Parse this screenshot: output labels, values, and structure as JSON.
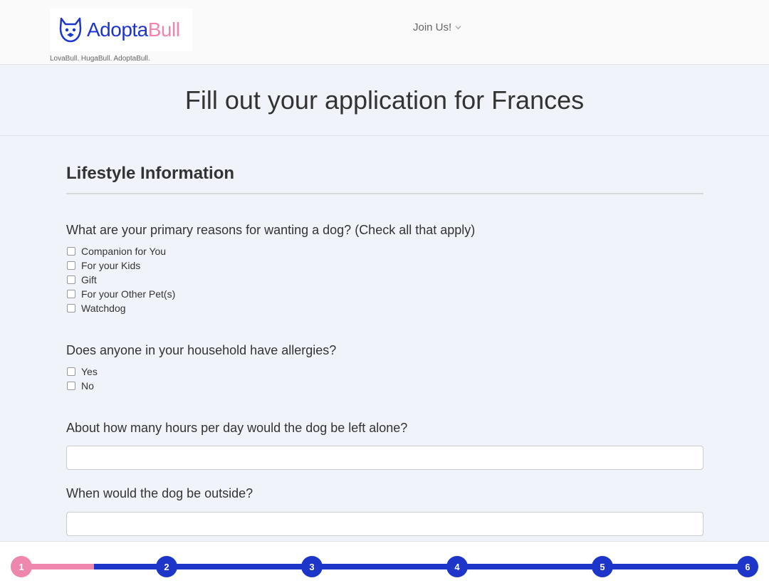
{
  "brand": {
    "name_part1": "Adopta",
    "name_part2": "Bull",
    "tagline": "LovaBull. HugaBull. AdoptaBull.",
    "colors": {
      "primary": "#1d35c9",
      "accent": "#ee86ad"
    },
    "logo_icon": "bulldog-face-icon"
  },
  "nav": {
    "join_label": "Join Us!",
    "join_icon": "chevron-down-icon"
  },
  "page": {
    "title": "Fill out your application for Frances"
  },
  "section": {
    "title": "Lifestyle Information"
  },
  "questions": {
    "reasons": {
      "label": "What are your primary reasons for wanting a dog? (Check all that apply)",
      "options": [
        "Companion for You",
        "For your Kids",
        "Gift",
        "For your Other Pet(s)",
        "Watchdog"
      ]
    },
    "allergies": {
      "label": "Does anyone in your household have allergies?",
      "options": [
        "Yes",
        "No"
      ]
    },
    "hours_alone": {
      "label": "About how many hours per day would the dog be left alone?",
      "value": "",
      "placeholder": ""
    },
    "outside": {
      "label": "When would the dog be outside?",
      "value": "",
      "placeholder": ""
    }
  },
  "progress": {
    "current_step": 1,
    "steps": [
      "1",
      "2",
      "3",
      "4",
      "5",
      "6"
    ]
  }
}
